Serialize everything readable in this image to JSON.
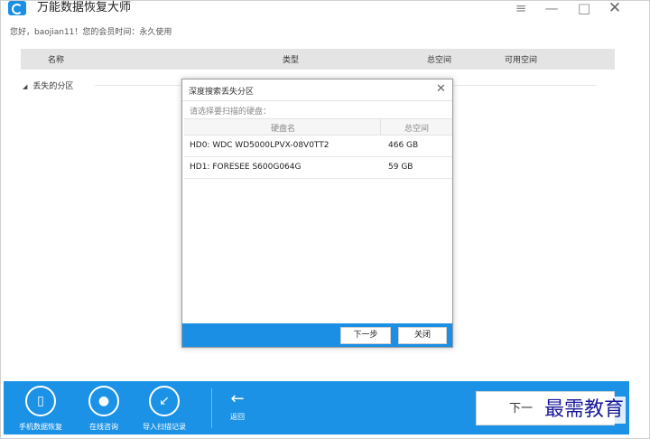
{
  "app": {
    "title": "万能数据恢复大师",
    "greeting": "您好，baojian11！您的会员时间：永久使用",
    "brand_color": "#1a8fe3"
  },
  "window_controls": {
    "menu_icon": "≡",
    "minimize_icon": "—",
    "maximize_icon": "□",
    "close_icon": "✕"
  },
  "table": {
    "headers": {
      "name": "名称",
      "type": "类型",
      "total": "总空间",
      "free": "可用空间"
    },
    "group_label": "丢失的分区"
  },
  "dialog": {
    "title": "深度搜索丢失分区",
    "prompt": "请选择要扫描的硬盘：",
    "columns": {
      "name": "硬盘名",
      "size": "总空间"
    },
    "disks": [
      {
        "name": "HD0: WDC WD5000LPVX-08V0TT2",
        "size": "466 GB"
      },
      {
        "name": "HD1: FORESEE S600G064G",
        "size": "59 GB"
      }
    ],
    "next_label": "下一步",
    "close_label": "关闭"
  },
  "toolbar": {
    "phone_label": "手机数据恢复",
    "consult_label": "在线咨询",
    "import_label": "导入扫描记录",
    "back_label": "返回",
    "next_label": "下一"
  },
  "watermark": "最需教育"
}
